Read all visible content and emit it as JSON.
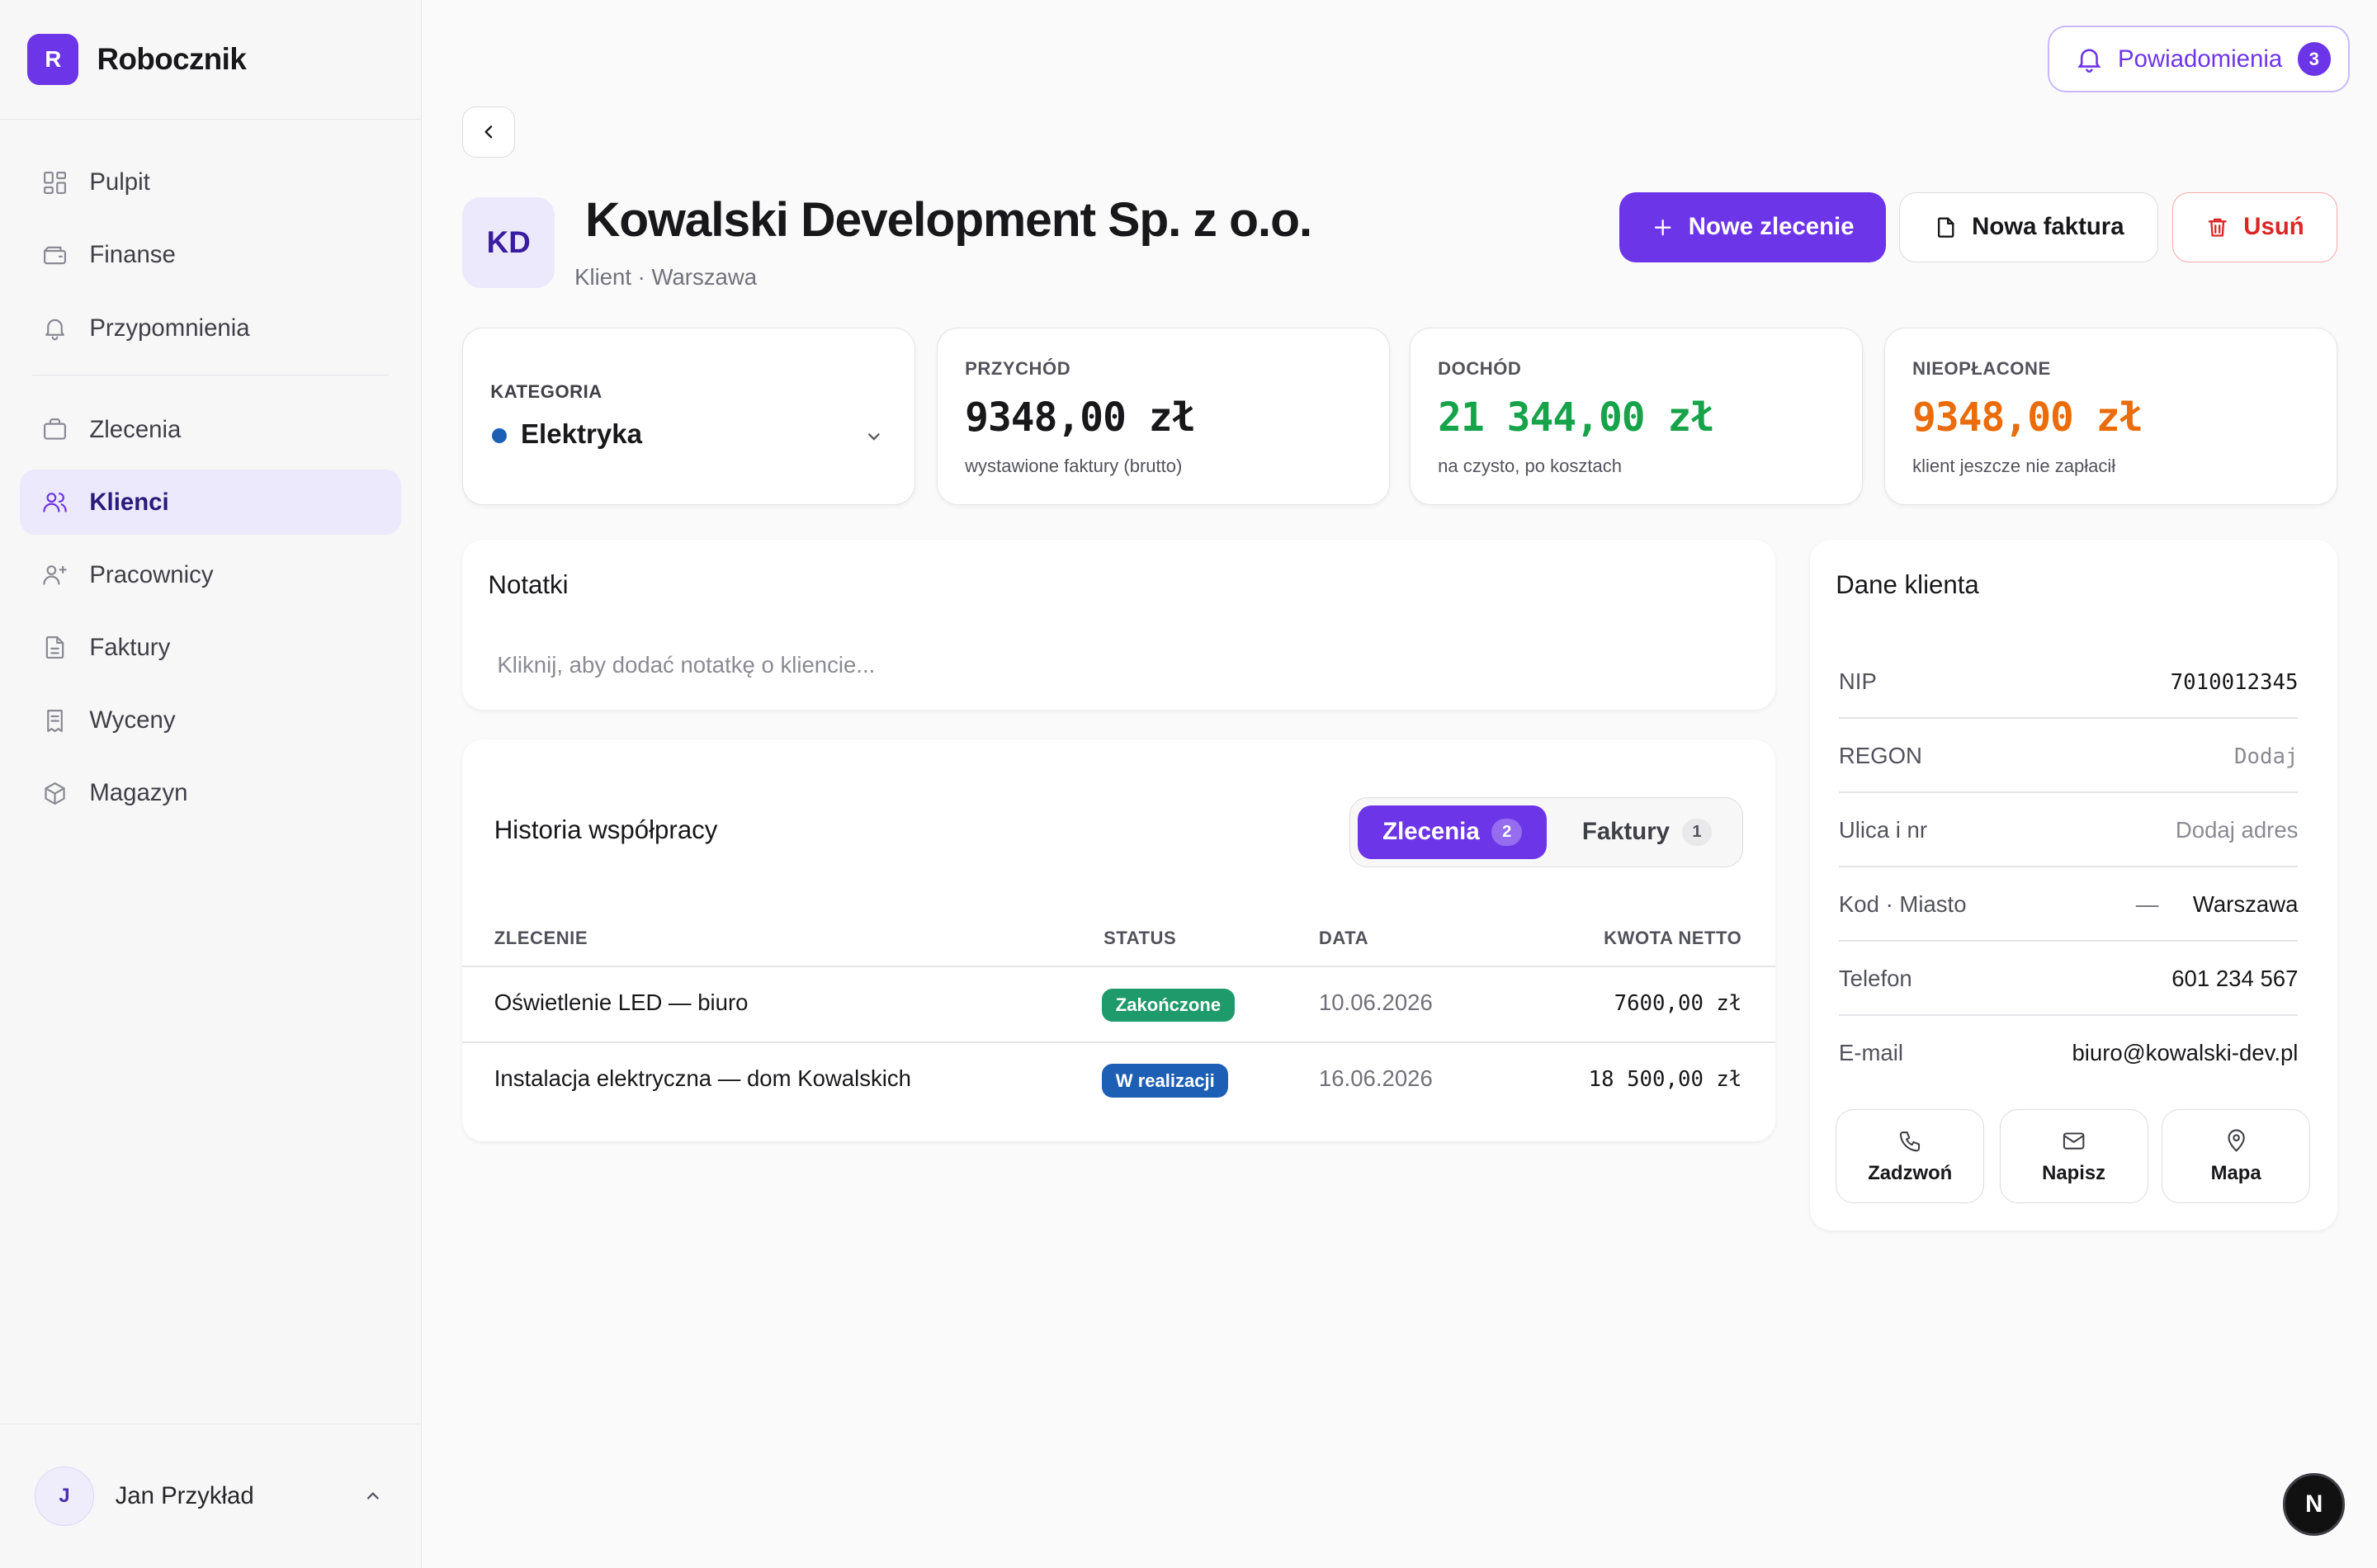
{
  "brand": {
    "logo": "R",
    "name": "Robocznik"
  },
  "sidebar": {
    "items": [
      {
        "label": "Pulpit",
        "icon": "grid-icon"
      },
      {
        "label": "Finanse",
        "icon": "wallet-icon"
      },
      {
        "label": "Przypomnienia",
        "icon": "bell-icon"
      },
      {
        "label": "Zlecenia",
        "icon": "briefcase-icon"
      },
      {
        "label": "Klienci",
        "icon": "users-icon",
        "active": true
      },
      {
        "label": "Pracownicy",
        "icon": "user-plus-icon"
      },
      {
        "label": "Faktury",
        "icon": "file-icon"
      },
      {
        "label": "Wyceny",
        "icon": "receipt-icon"
      },
      {
        "label": "Magazyn",
        "icon": "box-icon"
      }
    ]
  },
  "user": {
    "initial": "J",
    "name": "Jan Przykład"
  },
  "notifications": {
    "label": "Powiadomienia",
    "count": "3"
  },
  "client": {
    "initials": "KD",
    "name": "Kowalski Development Sp. z o.o.",
    "subtitle": "Klient · Warszawa"
  },
  "actions": {
    "new_order": "Nowe zlecenie",
    "new_invoice": "Nowa faktura",
    "delete": "Usuń"
  },
  "category": {
    "label": "KATEGORIA",
    "value": "Elektryka",
    "color": "#1d5fb4"
  },
  "stats": {
    "revenue": {
      "label": "PRZYCHÓD",
      "value": "9348,00 zł",
      "sub": "wystawione faktury (brutto)",
      "color": "#18181b"
    },
    "income": {
      "label": "DOCHÓD",
      "value": "21 344,00 zł",
      "sub": "na czysto, po kosztach",
      "color": "#16a34a"
    },
    "unpaid": {
      "label": "NIEOPŁACONE",
      "value": "9348,00 zł",
      "sub": "klient jeszcze nie zapłacił",
      "color": "#ea6c0a"
    }
  },
  "notes": {
    "title": "Notatki",
    "placeholder": "Kliknij, aby dodać notatkę o kliencie..."
  },
  "history": {
    "title": "Historia współpracy",
    "tabs": [
      {
        "label": "Zlecenia",
        "count": "2",
        "active": true
      },
      {
        "label": "Faktury",
        "count": "1",
        "active": false
      }
    ],
    "columns": [
      "ZLECENIE",
      "STATUS",
      "DATA",
      "KWOTA NETTO"
    ],
    "rows": [
      {
        "name": "Oświetlenie LED — biuro",
        "status": "Zakończone",
        "status_color": "#1f9a6a",
        "date": "10.06.2026",
        "amount": "7600,00 zł"
      },
      {
        "name": "Instalacja elektryczna — dom Kowalskich",
        "status": "W realizacji",
        "status_color": "#1d5fb4",
        "date": "16.06.2026",
        "amount": "18 500,00 zł"
      }
    ]
  },
  "client_data": {
    "title": "Dane klienta",
    "fields": {
      "nip": {
        "label": "NIP",
        "value": "7010012345"
      },
      "regon": {
        "label": "REGON",
        "value": "Dodaj"
      },
      "street": {
        "label": "Ulica i nr",
        "value": "Dodaj adres"
      },
      "city": {
        "label": "Kod · Miasto",
        "code": "—",
        "value": "Warszawa"
      },
      "phone": {
        "label": "Telefon",
        "value": "601 234 567"
      },
      "email": {
        "label": "E-mail",
        "value": "biuro@kowalski-dev.pl"
      }
    },
    "buttons": {
      "call": "Zadzwoń",
      "write": "Napisz",
      "map": "Mapa"
    }
  },
  "fab": {
    "label": "N"
  },
  "colors": {
    "accent": "#6d35e8",
    "danger": "#dc2626"
  }
}
